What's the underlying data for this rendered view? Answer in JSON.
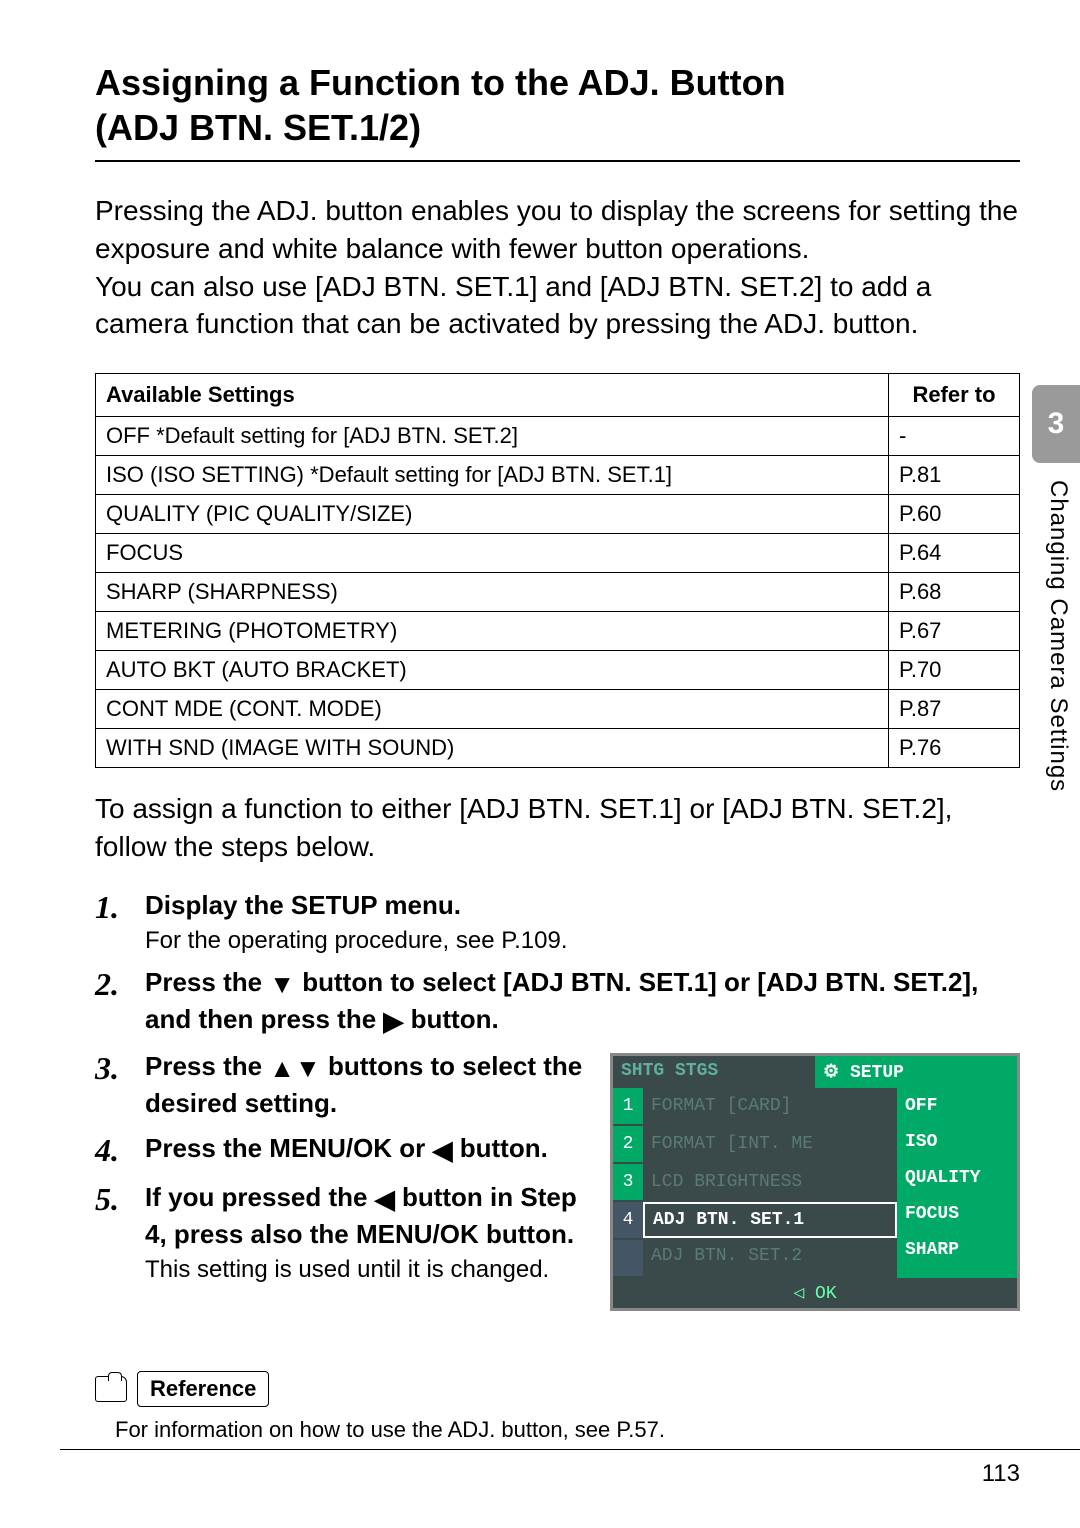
{
  "title_line1": "Assigning a Function to the ADJ. Button",
  "title_line2": "(ADJ BTN. SET.1/2)",
  "intro": "Pressing the ADJ. button enables you to display the screens for setting the exposure and white balance with fewer button operations.\nYou can also use [ADJ BTN. SET.1] and [ADJ BTN. SET.2] to add a camera function that can be activated by pressing the ADJ. button.",
  "table": {
    "head_setting": "Available Settings",
    "head_ref": "Refer to",
    "rows": [
      {
        "s": "OFF *Default setting for [ADJ BTN. SET.2]",
        "r": "-"
      },
      {
        "s": "ISO (ISO SETTING) *Default setting for [ADJ BTN. SET.1]",
        "r": "P.81"
      },
      {
        "s": "QUALITY (PIC QUALITY/SIZE)",
        "r": "P.60"
      },
      {
        "s": "FOCUS",
        "r": "P.64"
      },
      {
        "s": "SHARP (SHARPNESS)",
        "r": "P.68"
      },
      {
        "s": "METERING (PHOTOMETRY)",
        "r": "P.67"
      },
      {
        "s": "AUTO BKT (AUTO BRACKET)",
        "r": "P.70"
      },
      {
        "s": "CONT MDE (CONT. MODE)",
        "r": "P.87"
      },
      {
        "s": "WITH SND (IMAGE WITH SOUND)",
        "r": "P.76"
      }
    ]
  },
  "after_table": "To assign a function to either [ADJ BTN. SET.1] or [ADJ BTN. SET.2], follow the steps below.",
  "steps": {
    "s1": {
      "n": "1.",
      "t": "Display the SETUP menu.",
      "note": "For the operating procedure, see P.109."
    },
    "s2": {
      "n": "2.",
      "t_a": "Press the ",
      "t_b": " button to select [ADJ BTN. SET.1] or [ADJ BTN. SET.2], and then press the ",
      "t_c": " button."
    },
    "s3": {
      "n": "3.",
      "t_a": "Press the ",
      "t_b": " buttons to select the desired setting."
    },
    "s4": {
      "n": "4.",
      "t_a": "Press the MENU/OK or ",
      "t_b": " button."
    },
    "s5": {
      "n": "5.",
      "t_a": "If you pressed the ",
      "t_b": " button in Step 4, press also the MENU/OK button.",
      "note": "This setting is used until it is changed."
    }
  },
  "lcd": {
    "tab1": "SHTG STGS",
    "tab2": "SETUP",
    "nums": [
      "1",
      "2",
      "3",
      "4",
      ""
    ],
    "left": [
      "FORMAT [CARD]",
      "FORMAT [INT. ME",
      "LCD BRIGHTNESS",
      "ADJ BTN. SET.1",
      "ADJ BTN. SET.2"
    ],
    "right": [
      "OFF",
      "ISO",
      "QUALITY",
      "FOCUS",
      "SHARP"
    ],
    "foot": "◁ OK"
  },
  "reference": {
    "label": "Reference",
    "text": "For information on how to use the ADJ. button, see P.57."
  },
  "side": {
    "chapter": "3",
    "label": "Changing Camera Settings"
  },
  "page_number": "113"
}
